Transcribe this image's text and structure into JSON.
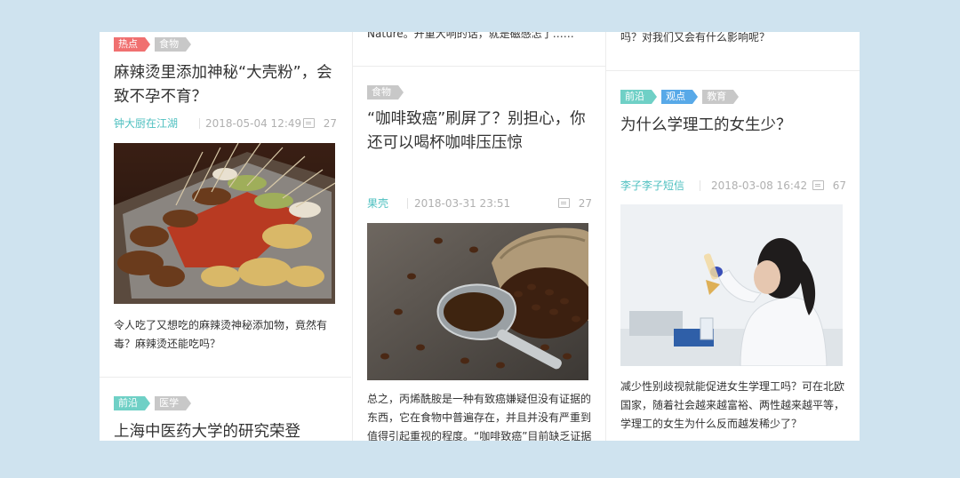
{
  "columns": [
    {
      "cards": [
        {
          "tags": [
            {
              "label": "热点",
              "color": "#f07070"
            },
            {
              "label": "食物",
              "color": "#c8c8c8"
            }
          ],
          "title": "麻辣烫里添加神秘“大壳粉”，会致不孕不育？",
          "author": "钟大厨在江湖",
          "date": "2018-05-04 12:49",
          "comments": "27",
          "image_icon": "skewers-photo",
          "summary": "令人吃了又想吃的麻辣烫神秘添加物，竟然有毒？麻辣烫还能吃吗？"
        },
        {
          "tags": [
            {
              "label": "前沿",
              "color": "#6fd0c6"
            },
            {
              "label": "医学",
              "color": "#c8c8c8"
            }
          ],
          "title": "上海中医药大学的研究荣登"
        }
      ]
    },
    {
      "snippet": "Nature。开重大响的话，就是磁感怎了……",
      "cards": [
        {
          "tags": [
            {
              "label": "食物",
              "color": "#c8c8c8"
            }
          ],
          "title": "“咖啡致癌”刷屏了？别担心，你还可以喝杯咖啡压压惊",
          "author": "果壳",
          "date": "2018-03-31 23:51",
          "comments": "27",
          "image_icon": "coffee-beans-photo",
          "summary": "总之，丙烯酰胺是一种有致癌嫌疑但没有证据的东西，它在食物中普遍存在，并且并没有严重到值得引起重视的程度。“咖啡致癌”目前缺乏证据支持。"
        }
      ]
    },
    {
      "snippet": "吗？对我们又会有什么影响呢？",
      "cards": [
        {
          "tags": [
            {
              "label": "前沿",
              "color": "#6fd0c6"
            },
            {
              "label": "观点",
              "color": "#58a9e8"
            },
            {
              "label": "教育",
              "color": "#c8c8c8"
            }
          ],
          "title": "为什么学理工的女生少？",
          "author": "李子李子短信",
          "date": "2018-03-08 16:42",
          "comments": "67",
          "image_icon": "lab-scientist-photo",
          "summary": "减少性别歧视就能促进女生学理工吗？可在北欧国家，随着社会越来越富裕、两性越来越平等，学理工的女生为什么反而越发稀少了？"
        }
      ]
    }
  ],
  "colors": {
    "background": "#cfe3ef",
    "author": "#4fc0c0",
    "tag_hot": "#f07070",
    "tag_gray": "#c8c8c8",
    "tag_frontier": "#6fd0c6",
    "tag_opinion": "#58a9e8"
  }
}
